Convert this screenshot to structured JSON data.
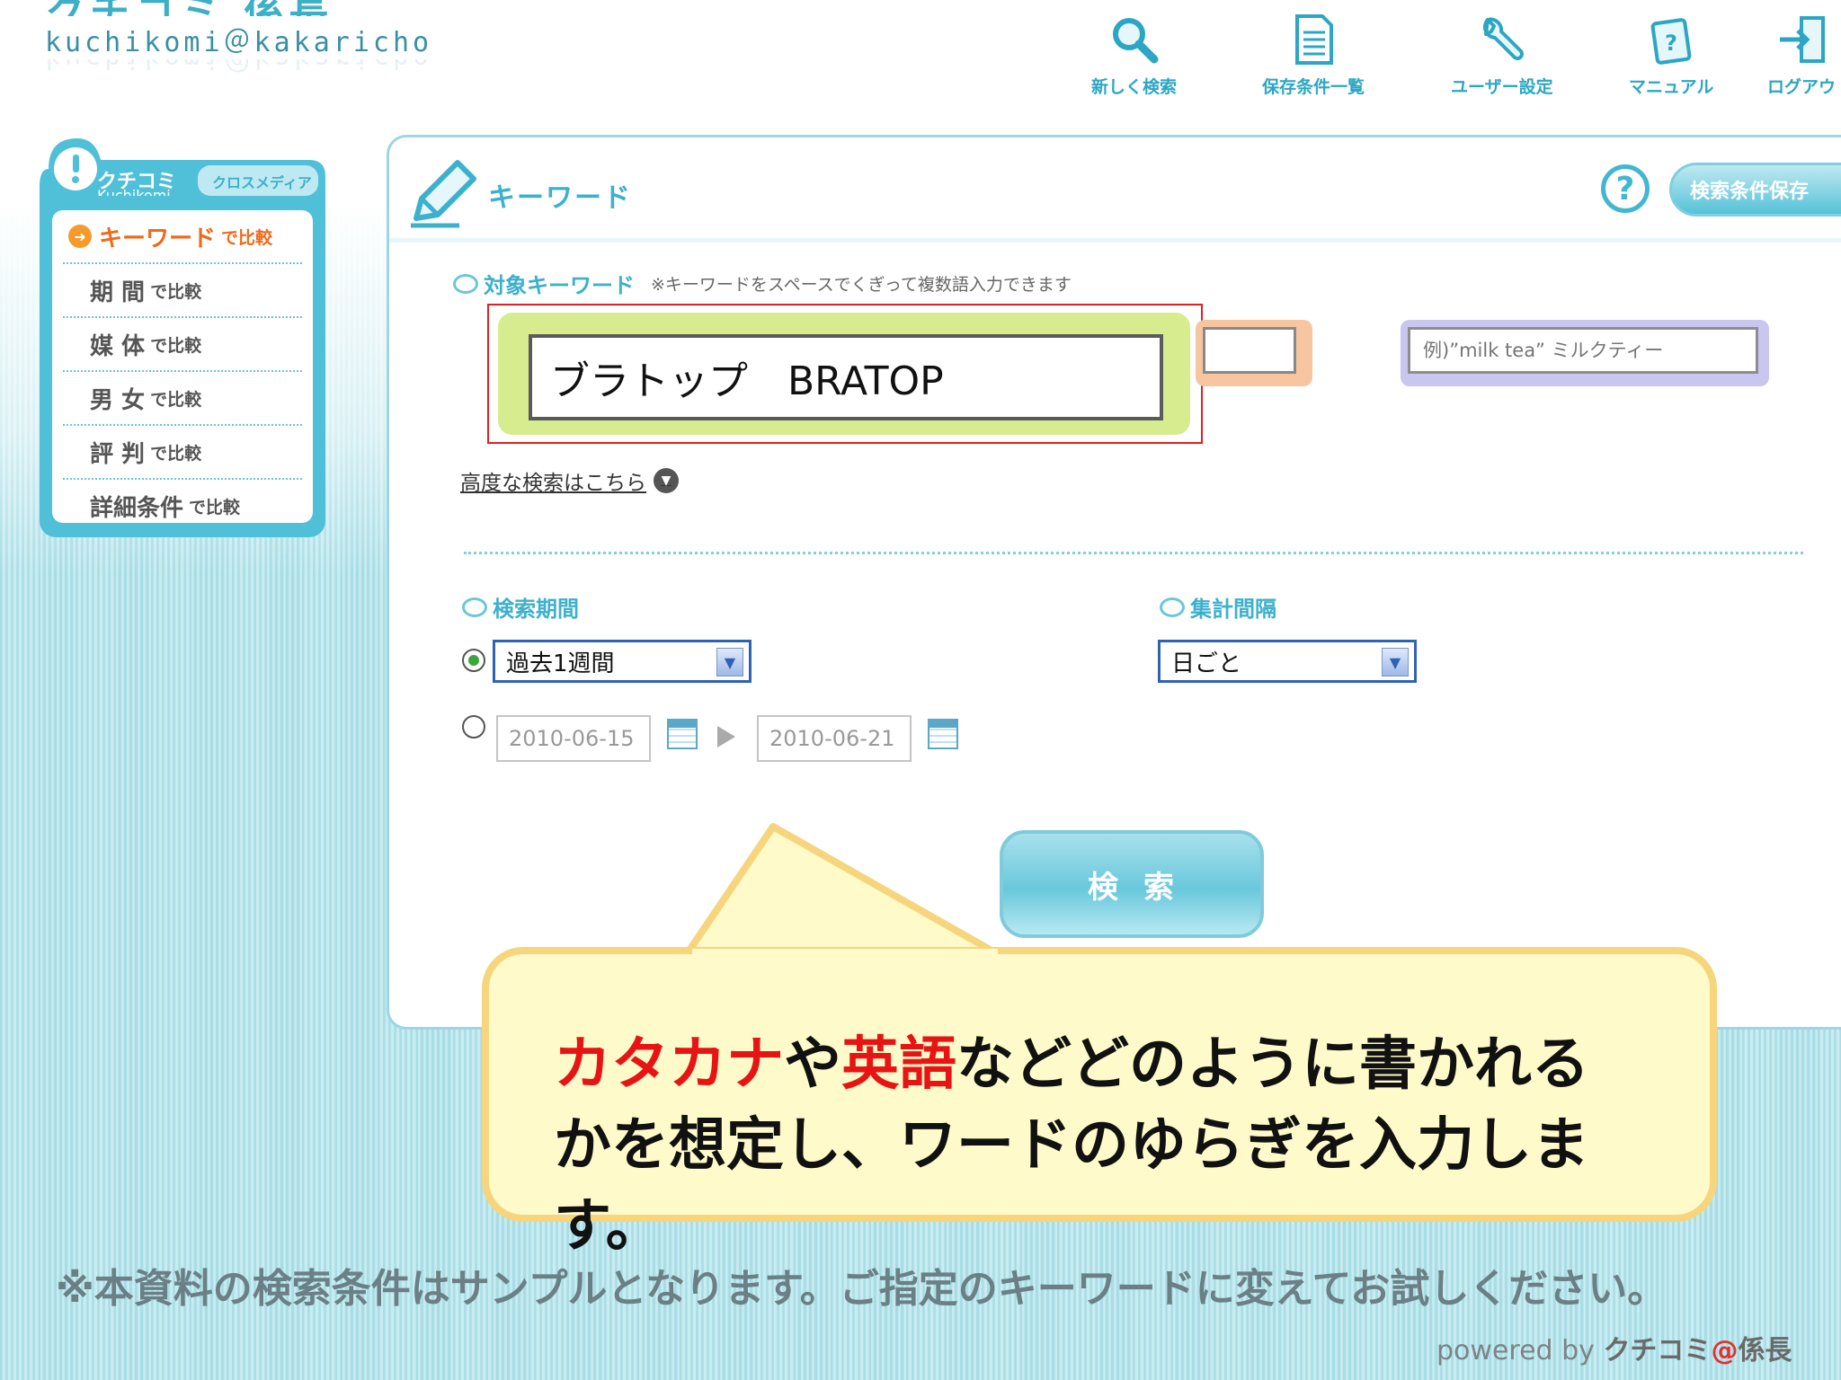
{
  "logo": {
    "text": "kuchikomi＠kakaricho"
  },
  "nav": [
    {
      "label": "新しく検索",
      "icon": "magnifier-icon"
    },
    {
      "label": "保存条件一覧",
      "icon": "document-icon"
    },
    {
      "label": "ユーザー設定",
      "icon": "wrench-icon"
    },
    {
      "label": "マニュアル",
      "icon": "manual-icon"
    },
    {
      "label": "ログアウ",
      "icon": "logout-icon"
    }
  ],
  "sidebar": {
    "tab_title": "クチコミ",
    "tab_sub": "Kuchikomi",
    "tab_cross": "クロスメディア",
    "items": [
      {
        "main": "キーワード",
        "suffix": "で比較"
      },
      {
        "main": "期 間",
        "suffix": "で比較"
      },
      {
        "main": "媒 体",
        "suffix": "で比較"
      },
      {
        "main": "男 女",
        "suffix": "で比較"
      },
      {
        "main": "評 判",
        "suffix": "で比較"
      },
      {
        "main": "詳細条件",
        "suffix": "で比較"
      }
    ]
  },
  "panel": {
    "title": "キーワード",
    "help": "?",
    "save_button": "検索条件保存",
    "target_label": "対象キーワード",
    "target_note": "※キーワードをスペースでくぎって複数語入力できます",
    "keyword_value": "ブラトップ　BRATOP",
    "keyword_placeholder": "例)”milk tea” ミルクティー",
    "advanced_link": "高度な検索はこちら",
    "period_label": "検索期間",
    "period_select": "過去1週間",
    "date_from": "2010-06-15",
    "date_to": "2010-06-21",
    "interval_label": "集計間隔",
    "interval_select": "日ごと",
    "search_button": "検索"
  },
  "callout": {
    "red1": "カタカナ",
    "black1": "や",
    "red2": "英語",
    "black2": "などどのように書かれる",
    "line2": "かを想定し、ワードのゆらぎを入力します。"
  },
  "footnote": "※本資料の検索条件はサンプルとなります。ご指定のキーワードに変えてお試しください。",
  "powered": {
    "prefix": "powered by ",
    "brand1": "クチコミ",
    "at": "@",
    "brand2": "係長"
  },
  "colors": {
    "accent": "#3cb0cc",
    "highlight_red": "#e81414",
    "callout_bg": "#fffac9"
  }
}
